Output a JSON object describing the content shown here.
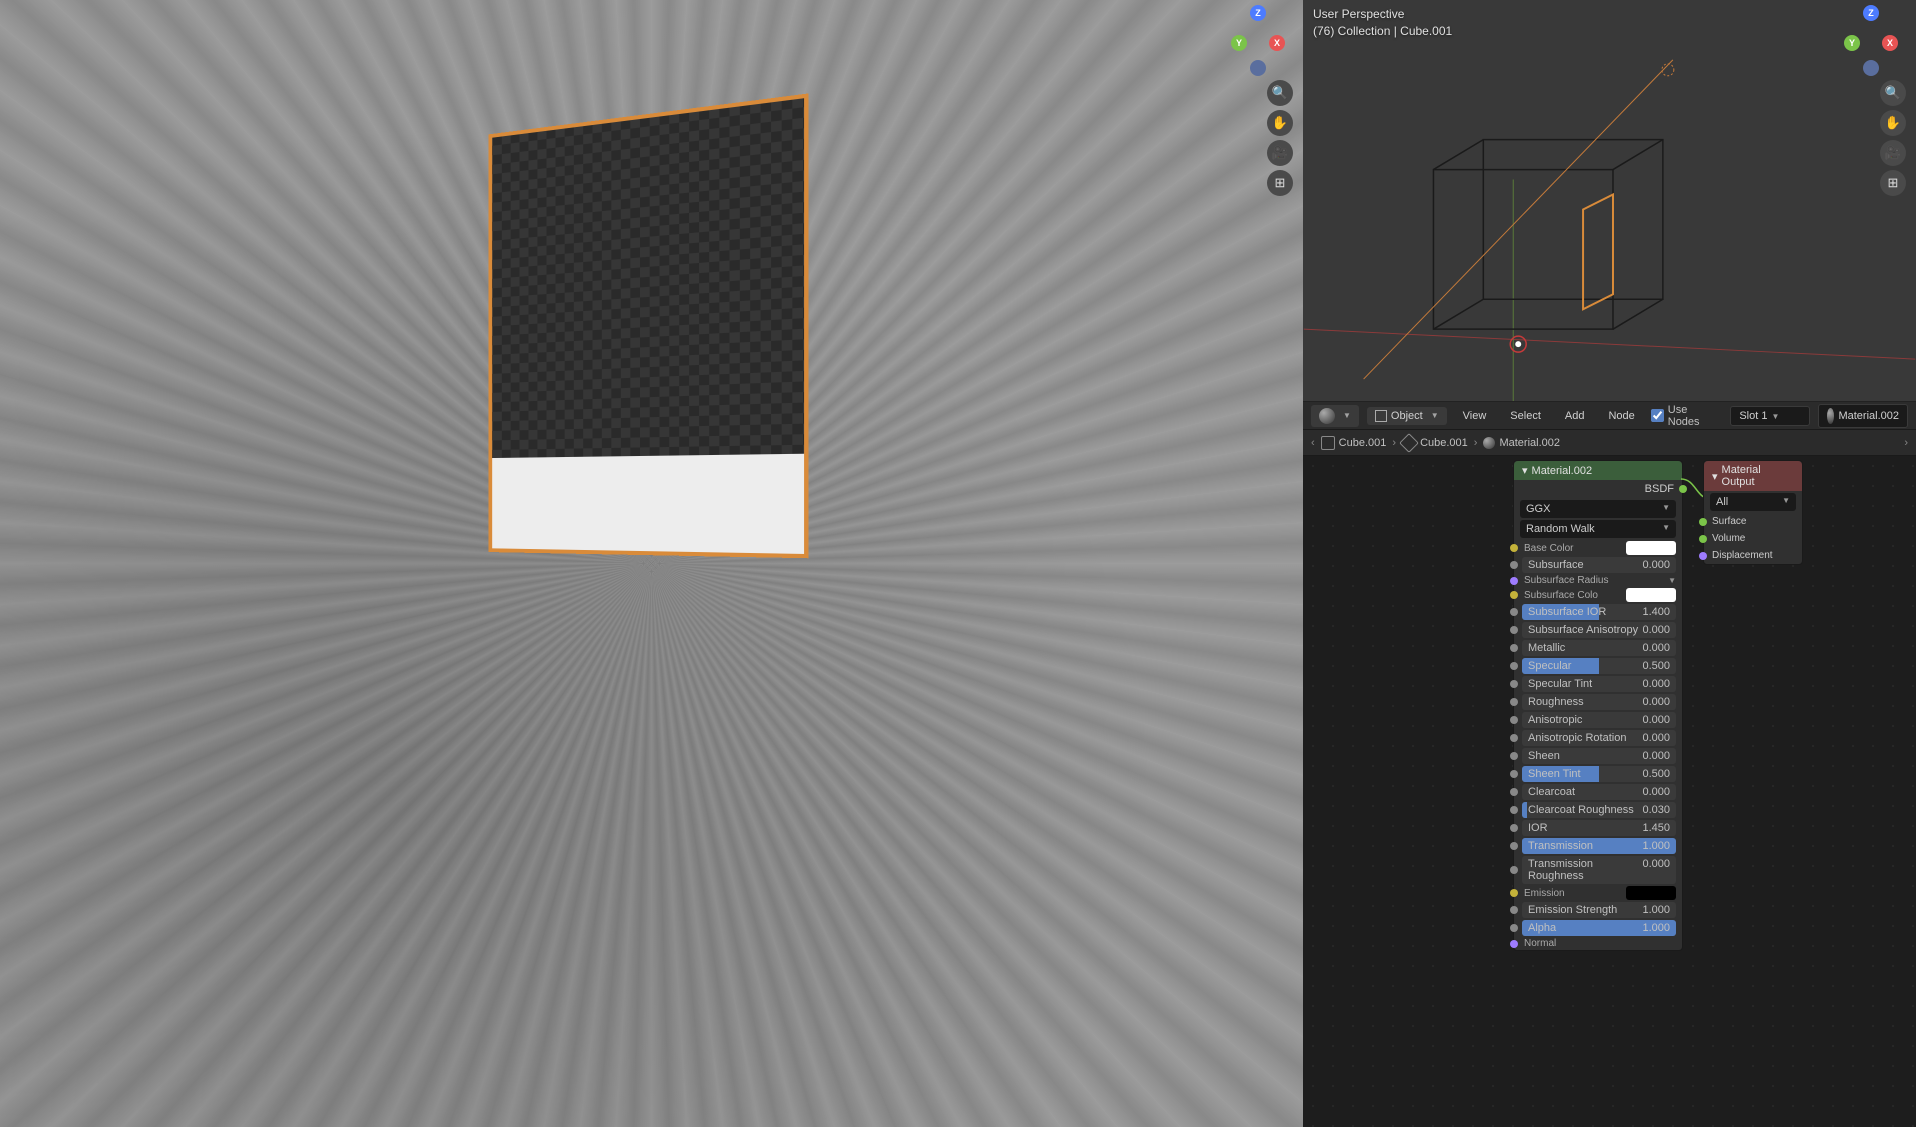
{
  "left_viewport": {},
  "right_viewport": {
    "perspective_line1": "User Perspective",
    "perspective_line2": "(76) Collection | Cube.001"
  },
  "nav_axes": {
    "x": "X",
    "y": "Y",
    "z": "Z"
  },
  "node_header": {
    "mode": "Object",
    "menus": {
      "view": "View",
      "select": "Select",
      "add": "Add",
      "node": "Node"
    },
    "use_nodes": "Use Nodes",
    "slot": "Slot 1",
    "material": "Material.002"
  },
  "breadcrumb": {
    "obj": "Cube.001",
    "mesh": "Cube.001",
    "material": "Material.002"
  },
  "bsdf_node": {
    "title": "Material.002",
    "output": "BSDF",
    "distribution": "GGX",
    "subsurface_method": "Random Walk",
    "inputs": [
      {
        "label": "Base Color",
        "type": "color",
        "color": "#ffffff",
        "socket": "yellow"
      },
      {
        "label": "Subsurface",
        "type": "slider",
        "value": "0.000",
        "fill": 0,
        "socket": "gray"
      },
      {
        "label": "Subsurface Radius",
        "type": "dropdown",
        "socket": "purple"
      },
      {
        "label": "Subsurface Colo",
        "type": "color",
        "color": "#ffffff",
        "socket": "yellow"
      },
      {
        "label": "Subsurface IOR",
        "type": "slider",
        "value": "1.400",
        "fill": 50,
        "socket": "gray"
      },
      {
        "label": "Subsurface Anisotropy",
        "type": "slider",
        "value": "0.000",
        "fill": 0,
        "socket": "gray"
      },
      {
        "label": "Metallic",
        "type": "slider",
        "value": "0.000",
        "fill": 0,
        "socket": "gray"
      },
      {
        "label": "Specular",
        "type": "slider",
        "value": "0.500",
        "fill": 50,
        "socket": "gray"
      },
      {
        "label": "Specular Tint",
        "type": "slider",
        "value": "0.000",
        "fill": 0,
        "socket": "gray"
      },
      {
        "label": "Roughness",
        "type": "slider",
        "value": "0.000",
        "fill": 0,
        "socket": "gray"
      },
      {
        "label": "Anisotropic",
        "type": "slider",
        "value": "0.000",
        "fill": 0,
        "socket": "gray"
      },
      {
        "label": "Anisotropic Rotation",
        "type": "slider",
        "value": "0.000",
        "fill": 0,
        "socket": "gray"
      },
      {
        "label": "Sheen",
        "type": "slider",
        "value": "0.000",
        "fill": 0,
        "socket": "gray"
      },
      {
        "label": "Sheen Tint",
        "type": "slider",
        "value": "0.500",
        "fill": 50,
        "socket": "gray"
      },
      {
        "label": "Clearcoat",
        "type": "slider",
        "value": "0.000",
        "fill": 0,
        "socket": "gray"
      },
      {
        "label": "Clearcoat Roughness",
        "type": "slider",
        "value": "0.030",
        "fill": 3,
        "socket": "gray"
      },
      {
        "label": "IOR",
        "type": "slider",
        "value": "1.450",
        "fill": 0,
        "socket": "gray"
      },
      {
        "label": "Transmission",
        "type": "slider",
        "value": "1.000",
        "fill": 100,
        "socket": "gray"
      },
      {
        "label": "Transmission Roughness",
        "type": "slider",
        "value": "0.000",
        "fill": 0,
        "socket": "gray"
      },
      {
        "label": "Emission",
        "type": "color",
        "color": "#000000",
        "socket": "yellow"
      },
      {
        "label": "Emission Strength",
        "type": "slider",
        "value": "1.000",
        "fill": 0,
        "socket": "gray"
      },
      {
        "label": "Alpha",
        "type": "slider",
        "value": "1.000",
        "fill": 100,
        "socket": "gray"
      },
      {
        "label": "Normal",
        "type": "label",
        "socket": "purple"
      }
    ]
  },
  "output_node": {
    "title": "Material Output",
    "target": "All",
    "inputs": [
      "Surface",
      "Volume",
      "Displacement"
    ]
  }
}
